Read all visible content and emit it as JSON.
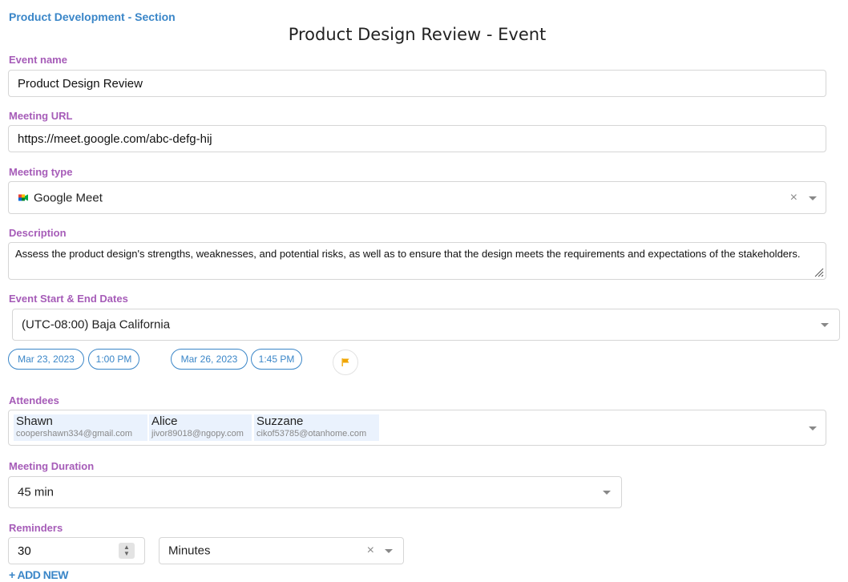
{
  "section": {
    "title": "Product Development - Section"
  },
  "event": {
    "title": "Product Design Review - Event"
  },
  "event_name": {
    "label": "Event name",
    "value": "Product Design Review"
  },
  "meeting_url": {
    "label": "Meeting URL",
    "value": "https://meet.google.com/abc-defg-hij"
  },
  "meeting_type": {
    "label": "Meeting type",
    "value": "Google Meet",
    "icon": "google-meet-icon"
  },
  "description": {
    "label": "Description",
    "value": "Assess the product design's strengths, weaknesses, and potential risks, as well as to ensure that the design meets the requirements and expectations of the stakeholders."
  },
  "dates": {
    "label": "Event Start & End Dates",
    "timezone": "(UTC-08:00) Baja California",
    "start_date": "Mar 23, 2023",
    "start_time": "1:00 PM",
    "end_date": "Mar 26, 2023",
    "end_time": "1:45 PM",
    "flag_icon": "flag-icon"
  },
  "attendees": {
    "label": "Attendees",
    "items": [
      {
        "name": "Shawn",
        "email": "coopershawn334@gmail.com"
      },
      {
        "name": "Alice",
        "email": "jivor89018@ngopy.com"
      },
      {
        "name": "Suzzane",
        "email": "cikof53785@otanhome.com"
      }
    ]
  },
  "duration": {
    "label": "Meeting Duration",
    "value": "45 min"
  },
  "reminders": {
    "label": "Reminders",
    "amount": "30",
    "unit": "Minutes",
    "add_new": "+ ADD NEW"
  },
  "colors": {
    "accent_blue": "#3a86c8",
    "label_purple": "#a65cb8",
    "flag_orange": "#f0a500"
  }
}
